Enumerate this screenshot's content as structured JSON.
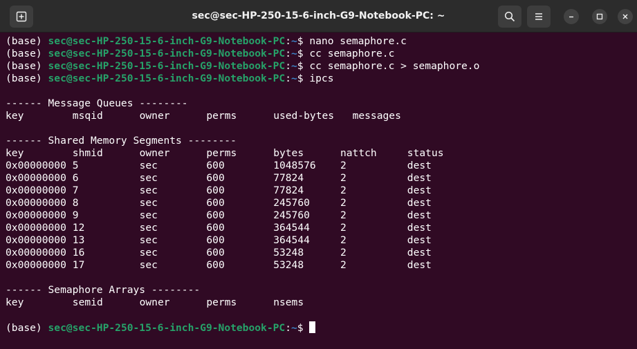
{
  "window": {
    "title": "sec@sec-HP-250-15-6-inch-G9-Notebook-PC: ~",
    "buttons": {
      "new_tab_icon": "new-tab-icon",
      "search_icon": "search-icon",
      "menu_icon": "hamburger-menu-icon",
      "minimize_icon": "minimize-icon",
      "maximize_icon": "maximize-icon",
      "close_icon": "close-icon"
    }
  },
  "prompt": {
    "env": "(base) ",
    "user_host": "sec@sec-HP-250-15-6-inch-G9-Notebook-PC",
    "colon": ":",
    "path": "~",
    "dollar": "$ "
  },
  "history": [
    {
      "command": "nano semaphore.c"
    },
    {
      "command": "cc semaphore.c"
    },
    {
      "command": "cc semaphore.c > semaphore.o"
    },
    {
      "command": "ipcs"
    }
  ],
  "ipcs": {
    "msg_header": "------ Message Queues --------",
    "msg_cols": [
      "key",
      "msqid",
      "owner",
      "perms",
      "used-bytes",
      "messages"
    ],
    "shm_header": "------ Shared Memory Segments --------",
    "shm_cols": [
      "key",
      "shmid",
      "owner",
      "perms",
      "bytes",
      "nattch",
      "status"
    ],
    "shm_rows": [
      [
        "0x00000000",
        "5",
        "sec",
        "600",
        "1048576",
        "2",
        "dest"
      ],
      [
        "0x00000000",
        "6",
        "sec",
        "600",
        "77824",
        "2",
        "dest"
      ],
      [
        "0x00000000",
        "7",
        "sec",
        "600",
        "77824",
        "2",
        "dest"
      ],
      [
        "0x00000000",
        "8",
        "sec",
        "600",
        "245760",
        "2",
        "dest"
      ],
      [
        "0x00000000",
        "9",
        "sec",
        "600",
        "245760",
        "2",
        "dest"
      ],
      [
        "0x00000000",
        "12",
        "sec",
        "600",
        "364544",
        "2",
        "dest"
      ],
      [
        "0x00000000",
        "13",
        "sec",
        "600",
        "364544",
        "2",
        "dest"
      ],
      [
        "0x00000000",
        "16",
        "sec",
        "600",
        "53248",
        "2",
        "dest"
      ],
      [
        "0x00000000",
        "17",
        "sec",
        "600",
        "53248",
        "2",
        "dest"
      ]
    ],
    "sem_header": "------ Semaphore Arrays --------",
    "sem_cols": [
      "key",
      "semid",
      "owner",
      "perms",
      "nsems"
    ]
  },
  "colors": {
    "background": "#300a24",
    "user_host": "#26a269",
    "path": "#3b82c4",
    "titlebar": "#2c2c2c"
  }
}
